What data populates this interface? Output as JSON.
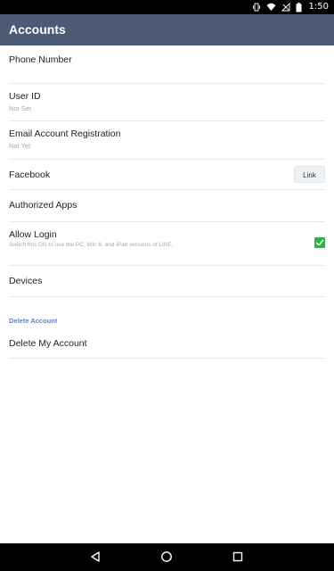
{
  "status_bar": {
    "time": "1:50",
    "icons": [
      "vibrate-icon",
      "wifi-icon",
      "no-signal-icon",
      "battery-icon"
    ]
  },
  "app_bar": {
    "title": "Accounts",
    "background_color": "#4d5a73"
  },
  "settings": {
    "phone_number": {
      "label": "Phone Number"
    },
    "user_id": {
      "label": "User ID",
      "value": "Not Set"
    },
    "email_registration": {
      "label": "Email Account Registration",
      "value": "Not Yet"
    },
    "facebook": {
      "label": "Facebook",
      "button_label": "Link"
    },
    "authorized_apps": {
      "label": "Authorized Apps"
    },
    "allow_login": {
      "label": "Allow Login",
      "description": "Switch this ON to use the PC, Win 8, and iPad versions of LINE.",
      "checked": true,
      "check_color": "#2fb344"
    },
    "devices": {
      "label": "Devices"
    }
  },
  "delete_section": {
    "header": "Delete Account",
    "header_color": "#5b87c5",
    "delete_item": {
      "label": "Delete My Account"
    }
  },
  "nav_bar": {
    "icons": [
      "back-icon",
      "home-icon",
      "recents-icon"
    ]
  }
}
